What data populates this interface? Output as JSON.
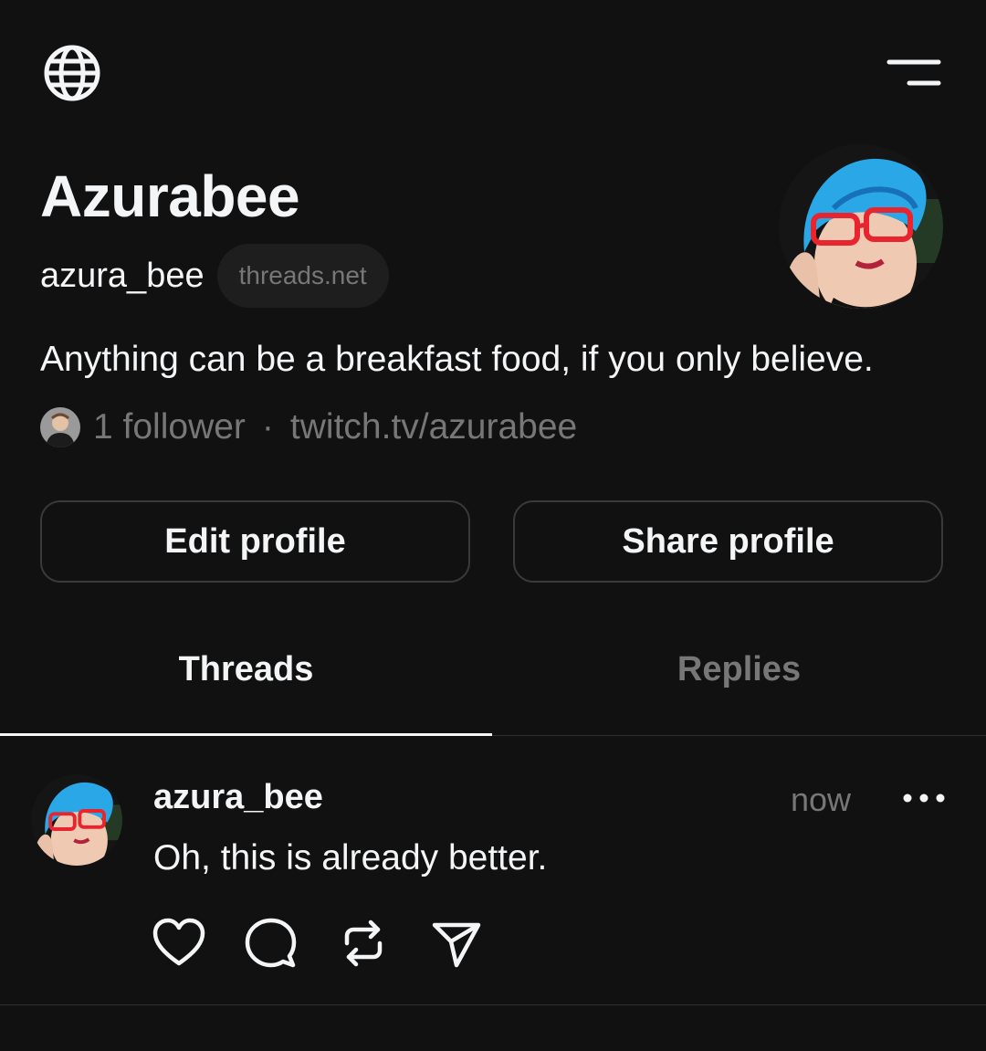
{
  "header": {
    "globe_icon": "globe-icon",
    "menu_icon": "hamburger-menu-icon"
  },
  "profile": {
    "display_name": "Azurabee",
    "username": "azura_bee",
    "domain_chip": "threads.net",
    "bio": "Anything can be a breakfast food, if you only believe.",
    "followers_text": "1 follower",
    "separator": "·",
    "link": "twitch.tv/azurabee"
  },
  "buttons": {
    "edit_label": "Edit profile",
    "share_label": "Share profile"
  },
  "tabs": [
    {
      "label": "Threads",
      "active": true
    },
    {
      "label": "Replies",
      "active": false
    }
  ],
  "post": {
    "username": "azura_bee",
    "time": "now",
    "text": "Oh, this is already better.",
    "actions": [
      "heart-icon",
      "comment-icon",
      "repost-icon",
      "send-icon"
    ]
  },
  "colors": {
    "background": "#111111",
    "text_primary": "#f3f5f7",
    "text_secondary": "#777777",
    "border": "#3a3a3a",
    "chip_bg": "#1e1e1e"
  }
}
